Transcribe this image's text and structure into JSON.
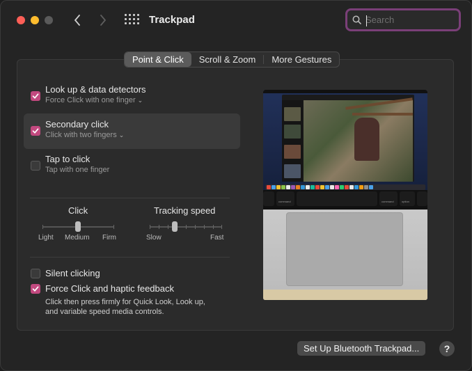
{
  "window": {
    "title": "Trackpad"
  },
  "search": {
    "placeholder": "Search"
  },
  "tabs": [
    {
      "label": "Point & Click",
      "active": true
    },
    {
      "label": "Scroll & Zoom",
      "active": false
    },
    {
      "label": "More Gestures",
      "active": false
    }
  ],
  "options": {
    "lookup": {
      "title": "Look up & data detectors",
      "subtitle": "Force Click with one finger",
      "checked": true
    },
    "secondary": {
      "title": "Secondary click",
      "subtitle": "Click with two fingers",
      "checked": true
    },
    "tap": {
      "title": "Tap to click",
      "subtitle": "Tap with one finger",
      "checked": false
    },
    "silent": {
      "title": "Silent clicking",
      "checked": false
    },
    "force": {
      "title": "Force Click and haptic feedback",
      "description_line1": "Click then press firmly for Quick Look, Look up,",
      "description_line2": "and variable speed media controls.",
      "checked": true
    }
  },
  "click_slider": {
    "label": "Click",
    "min_label": "Light",
    "mid_label": "Medium",
    "max_label": "Firm",
    "value": "Medium"
  },
  "speed_slider": {
    "label": "Tracking speed",
    "min_label": "Slow",
    "max_label": "Fast",
    "value_fraction": 0.35
  },
  "preview": {
    "keys": {
      "left_cmd": "command",
      "right_cmd": "command",
      "option": "option"
    }
  },
  "buttons": {
    "setup": "Set Up Bluetooth Trackpad...",
    "help": "?"
  },
  "colors": {
    "accent": "#c2497f",
    "search_focus": "#7a3f78"
  }
}
